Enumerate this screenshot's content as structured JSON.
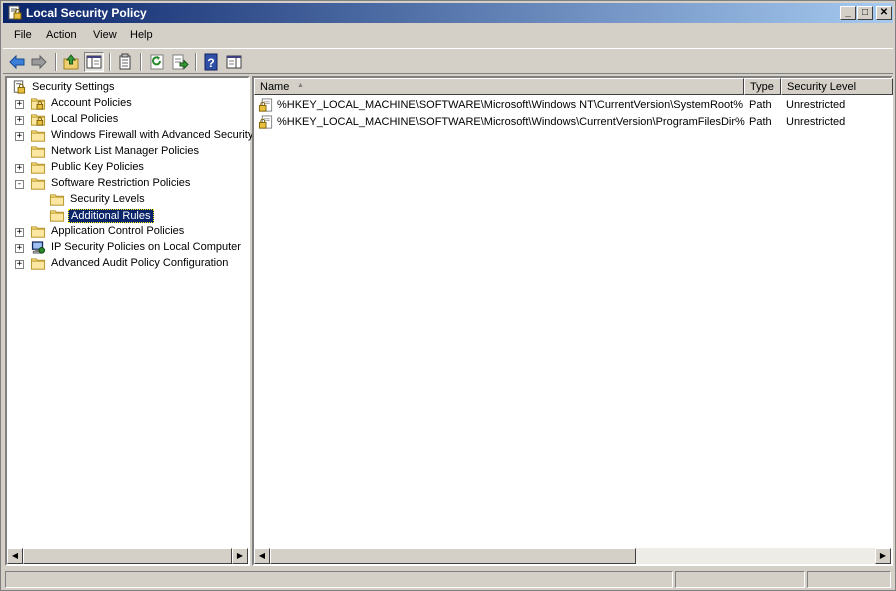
{
  "window": {
    "title": "Local Security Policy",
    "title_icon": "security-policy-icon",
    "controls": [
      "minimize",
      "maximize",
      "close"
    ]
  },
  "menu": [
    "File",
    "Action",
    "View",
    "Help"
  ],
  "toolbar": {
    "buttons": [
      "back-icon",
      "forward-icon",
      "up-icon",
      "show-hide-tree-icon",
      "properties-icon",
      "refresh-icon",
      "export-list-icon",
      "help-icon",
      "show-hide-action-pane-icon"
    ]
  },
  "tree": {
    "root": "Security Settings",
    "items": [
      {
        "label": "Account Policies",
        "expander": "+",
        "icon": "policy-folder-icon",
        "level": 1
      },
      {
        "label": "Local Policies",
        "expander": "+",
        "icon": "policy-folder-icon",
        "level": 1
      },
      {
        "label": "Windows Firewall with Advanced Security",
        "expander": "+",
        "icon": "folder-icon",
        "level": 1
      },
      {
        "label": "Network List Manager Policies",
        "expander": "",
        "icon": "folder-icon",
        "level": 1
      },
      {
        "label": "Public Key Policies",
        "expander": "+",
        "icon": "folder-icon",
        "level": 1
      },
      {
        "label": "Software Restriction Policies",
        "expander": "−",
        "icon": "folder-icon",
        "level": 1
      },
      {
        "label": "Security Levels",
        "expander": "",
        "icon": "folder-icon",
        "level": 2
      },
      {
        "label": "Additional Rules",
        "expander": "",
        "icon": "folder-icon",
        "level": 2,
        "selected": true
      },
      {
        "label": "Application Control Policies",
        "expander": "+",
        "icon": "folder-icon",
        "level": 1
      },
      {
        "label": "IP Security Policies on Local Computer",
        "expander": "+",
        "icon": "ip-security-icon",
        "level": 1
      },
      {
        "label": "Advanced Audit Policy Configuration",
        "expander": "+",
        "icon": "folder-icon",
        "level": 1
      }
    ]
  },
  "list": {
    "columns": [
      "Name",
      "Type",
      "Security Level"
    ],
    "sort_indicator": "▲",
    "rows": [
      {
        "name": "%HKEY_LOCAL_MACHINE\\SOFTWARE\\Microsoft\\Windows NT\\CurrentVersion\\SystemRoot%",
        "type": "Path",
        "level": "Unrestricted"
      },
      {
        "name": "%HKEY_LOCAL_MACHINE\\SOFTWARE\\Microsoft\\Windows\\CurrentVersion\\ProgramFilesDir%",
        "type": "Path",
        "level": "Unrestricted"
      }
    ]
  },
  "colors": {
    "title_start": "#0a246a",
    "title_end": "#a6caf0",
    "selection": "#0a246a"
  }
}
